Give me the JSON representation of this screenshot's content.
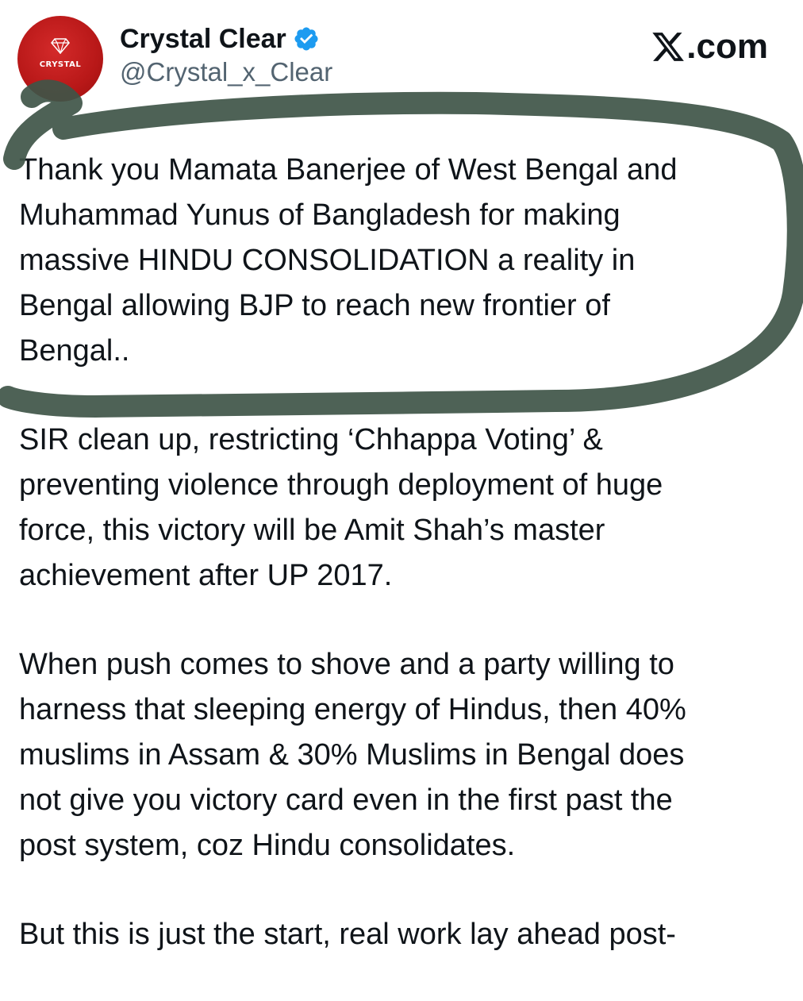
{
  "author": {
    "display_name": "Crystal Clear",
    "handle": "@Crystal_x_Clear",
    "avatar_text": "CRYSTAL",
    "avatar_color": "#c41e1e",
    "verified": true,
    "verified_color": "#1d9bf0"
  },
  "site": {
    "label": ".com"
  },
  "tweet": {
    "paragraphs": [
      "Thank you Mamata Banerjee of West Bengal and\nMuhammad Yunus of Bangladesh for making\nmassive HINDU CONSOLIDATION a reality in\nBengal allowing BJP to reach new frontier of\nBengal..",
      "SIR clean up, restricting ‘Chhappa Voting’ &\npreventing violence through deployment of huge\nforce, this victory will be Amit Shah’s master\nachievement after UP 2017.",
      "When push comes to shove and a party willing to\nharness that sleeping energy of Hindus, then 40%\nmuslims in Assam & 30% Muslims in Bengal does\nnot give you victory card even in the first past the\npost system, coz Hindu consolidates.",
      "But this is just the start, real work lay ahead post-"
    ]
  },
  "annotation": {
    "color": "#3f5548"
  }
}
